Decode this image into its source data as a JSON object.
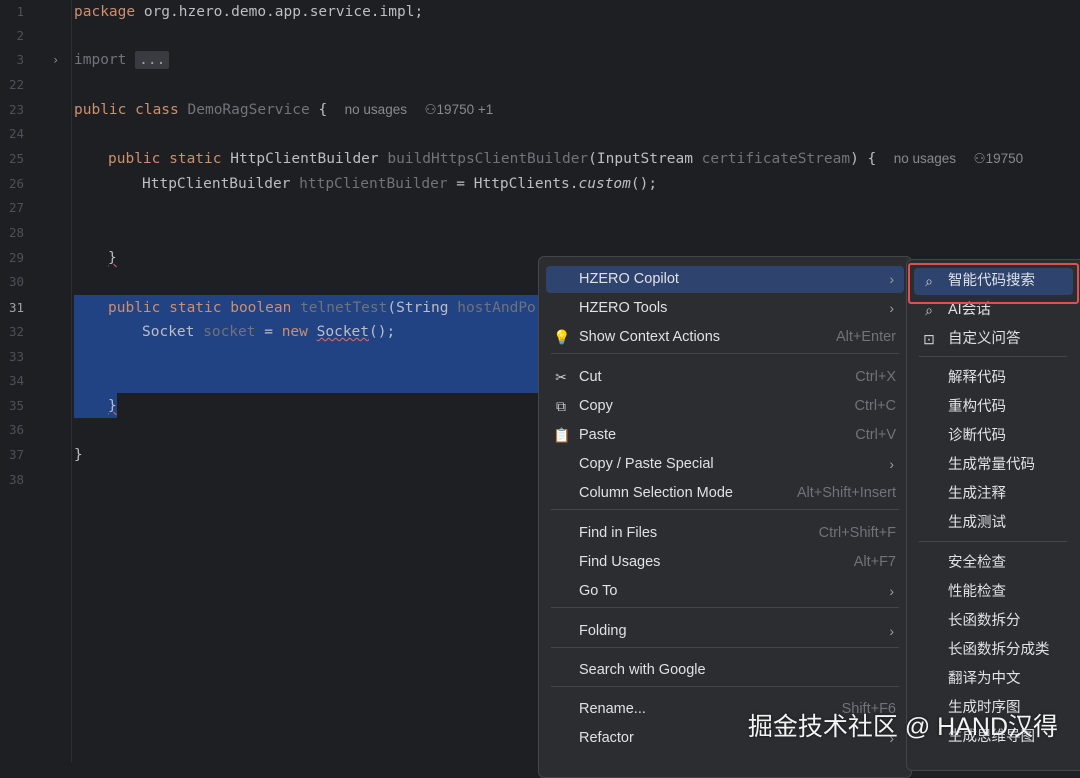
{
  "editor": {
    "lines": [
      {
        "num": "1"
      },
      {
        "num": "2"
      },
      {
        "num": "3"
      },
      {
        "num": "22"
      },
      {
        "num": "23"
      },
      {
        "num": "24"
      },
      {
        "num": "25"
      },
      {
        "num": "26"
      },
      {
        "num": "27"
      },
      {
        "num": "28"
      },
      {
        "num": "29"
      },
      {
        "num": "30"
      },
      {
        "num": "31"
      },
      {
        "num": "32"
      },
      {
        "num": "33"
      },
      {
        "num": "34"
      },
      {
        "num": "35"
      },
      {
        "num": "36"
      },
      {
        "num": "37"
      },
      {
        "num": "38"
      }
    ],
    "code": {
      "package_kw": "package",
      "package_name": " org.hzero.demo.app.service.impl;",
      "import_kw": "import",
      "import_collapsed": "...",
      "class_mod": "public class",
      "class_name": "DemoRagService",
      "class_brace": " {",
      "class_usages": "no usages",
      "class_author": "19750 +1",
      "m1_mods": "public static",
      "m1_type": "HttpClientBuilder",
      "m1_name": "buildHttpsClientBuilder",
      "m1_open": "(InputStream ",
      "m1_param": "certificateStream",
      "m1_close": ") {",
      "m1_usages": "no usages",
      "m1_author": "19750",
      "l26_type": "HttpClientBuilder ",
      "l26_var": "httpClientBuilder",
      "l26_eq": " = HttpClients.",
      "l26_call": "custom",
      "l26_end": "();",
      "brace_close": "}",
      "m2_mods": "public static boolean",
      "m2_name": "telnetTest",
      "m2_open": "(String ",
      "m2_param": "hostAndPort",
      "l32_type": "Socket ",
      "l32_var": "socket",
      "l32_eq": " = ",
      "l32_new": "new",
      "l32_ctor": "Socket",
      "l32_end": "();",
      "class_close": "}"
    }
  },
  "context_menu": {
    "items": [
      {
        "label": "HZERO Copilot",
        "submenu": true,
        "active": true
      },
      {
        "label": "HZERO Tools",
        "submenu": true
      },
      {
        "label": "Show Context Actions",
        "shortcut": "Alt+Enter",
        "icon": "bulb-icon"
      },
      {
        "label": "Cut",
        "shortcut": "Ctrl+X",
        "icon": "scissors-icon"
      },
      {
        "label": "Copy",
        "shortcut": "Ctrl+C",
        "icon": "copy-icon"
      },
      {
        "label": "Paste",
        "shortcut": "Ctrl+V",
        "icon": "clipboard-icon"
      },
      {
        "label": "Copy / Paste Special",
        "submenu": true
      },
      {
        "label": "Column Selection Mode",
        "shortcut": "Alt+Shift+Insert"
      },
      {
        "label": "Find in Files",
        "shortcut": "Ctrl+Shift+F"
      },
      {
        "label": "Find Usages",
        "shortcut": "Alt+F7"
      },
      {
        "label": "Go To",
        "submenu": true
      },
      {
        "label": "Folding",
        "submenu": true
      },
      {
        "label": "Search with Google"
      },
      {
        "label": "Rename...",
        "shortcut": "Shift+F6"
      },
      {
        "label": "Refactor",
        "submenu": true
      }
    ]
  },
  "copilot_submenu": {
    "items": [
      {
        "label": "智能代码搜索",
        "icon": "search-icon",
        "highlighted": true
      },
      {
        "label": "AI会话",
        "icon": "search-icon"
      },
      {
        "label": "自定义问答",
        "icon": "terminal-icon"
      },
      {
        "label": "解释代码"
      },
      {
        "label": "重构代码"
      },
      {
        "label": "诊断代码"
      },
      {
        "label": "生成常量代码"
      },
      {
        "label": "生成注释"
      },
      {
        "label": "生成测试"
      },
      {
        "label": "安全检查"
      },
      {
        "label": "性能检查"
      },
      {
        "label": "长函数拆分"
      },
      {
        "label": "长函数拆分成类"
      },
      {
        "label": "翻译为中文"
      },
      {
        "label": "生成时序图"
      },
      {
        "label": "生成思维导图"
      }
    ]
  },
  "watermark": "掘金技术社区 @ HAND汉得",
  "colors": {
    "background": "#1e1f22",
    "selection": "#214283",
    "menu_bg": "#2b2d30",
    "menu_active": "#2e436e",
    "keyword": "#cf8e6d",
    "function": "#56a8f5",
    "highlight_border": "#e05050"
  }
}
